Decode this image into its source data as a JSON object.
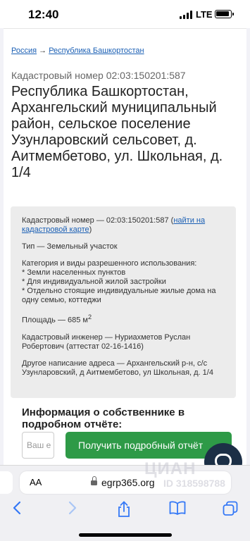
{
  "status_bar": {
    "time": "12:40",
    "network": "LTE",
    "icons": [
      "signal-icon",
      "battery-icon"
    ]
  },
  "breadcrumb": {
    "items": [
      "Россия",
      "Республика Башкортостан"
    ],
    "separator": "→"
  },
  "header": {
    "cadastral_label": "Кадастровый номер 02:03:150201:587",
    "title": "Республика Башкортостан, Архангельский муниципальный район, сельское поселение Узунларовский сельсовет, д. Аитмембетово, ул. Школьная, д. 1/4"
  },
  "info": {
    "cadastral_prefix": "Кадастровый номер — 02:03:150201:587 (",
    "map_link": "найти на кадастровой карте",
    "cadastral_suffix": ")",
    "type": "Тип — Земельный участок",
    "category_heading": "Категория и виды разрешенного использования:",
    "category_items": [
      "* Земли населенных пунктов",
      "* Для индивидуальной жилой застройки",
      "* Отдельно стоящие индивидуальные жилые дома на одну семью, коттеджи"
    ],
    "area_prefix": "Площадь — 685 м",
    "area_unit_sup": "2",
    "engineer": "Кадастровый инженер — Нуриахметов Руслан Робертович (аттестат 02-16-1416)",
    "alt_address": "Другое написание адреса — Архангельский р-н, с/с Узунларовский, д Аитмембетово, ул Школьная, д. 1/4"
  },
  "owner_section": {
    "title": "Информация о собственнике в подробном отчёте:",
    "email_placeholder": "Ваш e",
    "button_label": "Получить подробный отчёт"
  },
  "safari": {
    "aa": "AA",
    "domain": "egrp365.org",
    "toolbar_icons": [
      "back-icon",
      "forward-icon",
      "share-icon",
      "bookmarks-icon",
      "tabs-icon"
    ]
  },
  "watermark": {
    "brand": "ЦИАН",
    "id": "ID 318598788"
  },
  "colors": {
    "link": "#1a5fb4",
    "button_green": "#2e9a47",
    "chat_navy": "#1c2f46",
    "ios_blue": "#3478f6"
  }
}
